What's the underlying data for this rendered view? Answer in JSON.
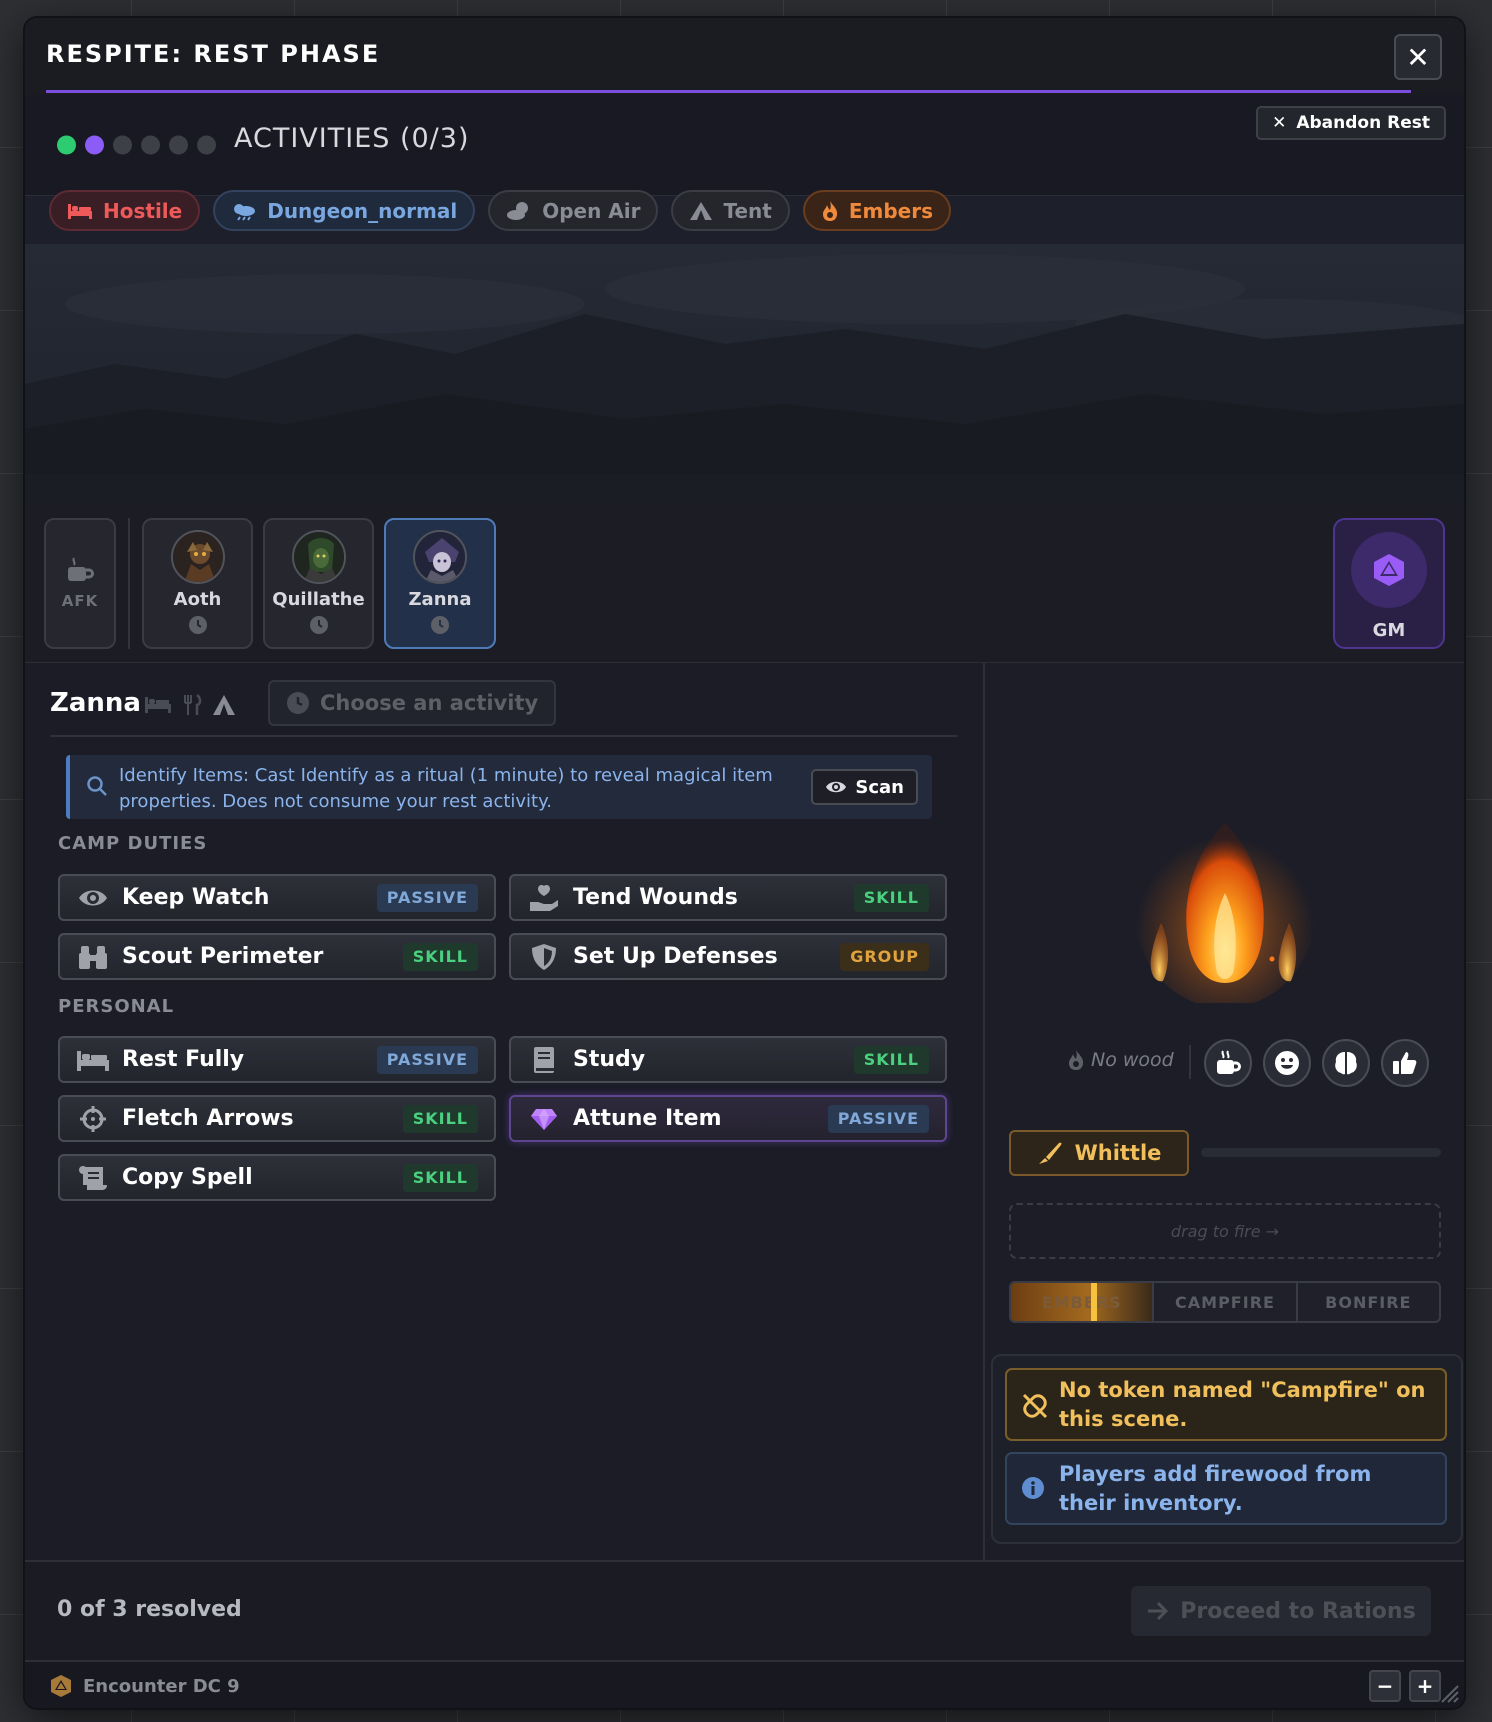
{
  "window": {
    "title": "RESPITE: REST PHASE",
    "close_icon": "✕",
    "accent_color": "#7c4dde"
  },
  "header": {
    "progress_dots": [
      "complete",
      "current",
      "pending",
      "pending",
      "pending",
      "pending"
    ],
    "activities_label": "ACTIVITIES (0/3)",
    "abandon_label": "Abandon Rest"
  },
  "tags": [
    {
      "label": "Hostile",
      "icon": "bed-icon"
    },
    {
      "label": "Dungeon_normal",
      "icon": "weather-icon"
    },
    {
      "label": "Open Air",
      "icon": "sky-icon"
    },
    {
      "label": "Tent",
      "icon": "tent-icon"
    },
    {
      "label": "Embers",
      "icon": "flame-icon"
    }
  ],
  "party": {
    "afk_label": "AFK",
    "members": [
      {
        "name": "Aoth",
        "status_icon": "clock-icon"
      },
      {
        "name": "Quillathe",
        "status_icon": "clock-icon"
      },
      {
        "name": "Zanna",
        "status_icon": "clock-icon",
        "selected": true
      }
    ],
    "gm_label": "GM"
  },
  "character": {
    "name": "Zanna",
    "choose_label": "Choose an activity"
  },
  "hint": {
    "text": "Identify Items: Cast Identify as a ritual (1 minute) to reveal magical item properties. Does not consume your rest activity.",
    "scan_label": "Scan"
  },
  "sections": {
    "camp_duties": "CAMP DUTIES",
    "personal": "PERSONAL"
  },
  "camp_activities": [
    {
      "label": "Keep Watch",
      "badge": "PASSIVE",
      "icon": "eye-icon"
    },
    {
      "label": "Tend Wounds",
      "badge": "SKILL",
      "icon": "hand-heart-icon"
    },
    {
      "label": "Scout Perimeter",
      "badge": "SKILL",
      "icon": "binoculars-icon"
    },
    {
      "label": "Set Up Defenses",
      "badge": "GROUP",
      "icon": "shield-icon"
    }
  ],
  "personal_activities": [
    {
      "label": "Rest Fully",
      "badge": "PASSIVE",
      "icon": "bed-icon"
    },
    {
      "label": "Study",
      "badge": "SKILL",
      "icon": "book-icon"
    },
    {
      "label": "Fletch Arrows",
      "badge": "SKILL",
      "icon": "crosshair-icon"
    },
    {
      "label": "Attune Item",
      "badge": "PASSIVE",
      "icon": "gem-icon"
    },
    {
      "label": "Copy Spell",
      "badge": "SKILL",
      "icon": "scroll-icon"
    }
  ],
  "campfire": {
    "fuel_label": "No wood",
    "moods": [
      "mug-icon",
      "smile-icon",
      "brain-icon",
      "thumbs-up-icon"
    ],
    "whittle_label": "Whittle",
    "drop_label": "drag to fire →",
    "levels": [
      "EMBERS",
      "CAMPFIRE",
      "BONFIRE"
    ],
    "active_level": "EMBERS",
    "warning": "No token named \"Campfire\" on this scene.",
    "info": "Players add firewood from their inventory."
  },
  "footer": {
    "resolved_label": "0 of 3 resolved",
    "proceed_label": "Proceed to Rations",
    "encounter_label": "Encounter DC 9",
    "zoom_out": "−",
    "zoom_in": "+"
  }
}
